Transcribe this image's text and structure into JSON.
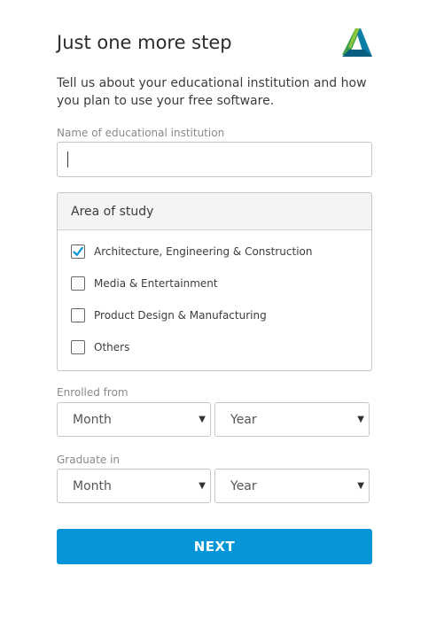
{
  "header": {
    "title": "Just one more step",
    "logo_icon": "autodesk-logo-icon"
  },
  "intro_text": "Tell us about your educational institution and how you plan to use your free software.",
  "institution": {
    "label": "Name of educational institution",
    "value": "",
    "placeholder": ""
  },
  "study": {
    "heading": "Area of study",
    "options": [
      {
        "label": "Architecture, Engineering & Construction",
        "checked": true
      },
      {
        "label": "Media & Entertainment",
        "checked": false
      },
      {
        "label": "Product Design & Manufacturing",
        "checked": false
      },
      {
        "label": "Others",
        "checked": false
      }
    ]
  },
  "enrolled": {
    "label": "Enrolled from",
    "month": "Month",
    "year": "Year"
  },
  "graduate": {
    "label": "Graduate in",
    "month": "Month",
    "year": "Year"
  },
  "next_label": "NEXT",
  "colors": {
    "accent": "#0696d7",
    "check": "#0696d7"
  }
}
